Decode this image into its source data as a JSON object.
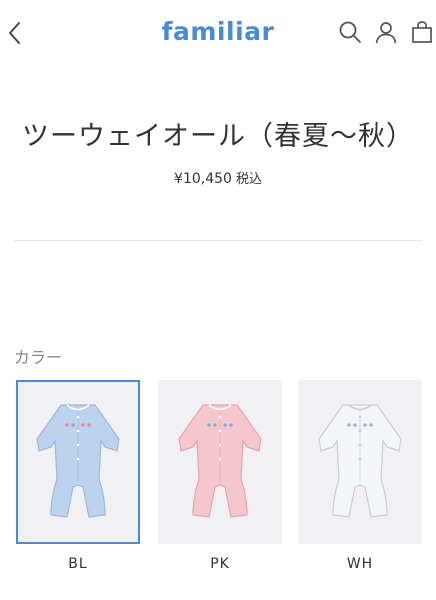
{
  "header": {
    "logo": "familiar",
    "icons": {
      "back": "chevron-left-icon",
      "search": "search-icon",
      "account": "user-icon",
      "bag": "shopping-bag-icon"
    },
    "brand_color": "#4a8ad0"
  },
  "product": {
    "title": "ツーウェイオール（春夏～秋）",
    "price": "¥10,450",
    "tax_label": "税込"
  },
  "color_section": {
    "label": "カラー",
    "selected": "BL",
    "options": [
      {
        "code": "BL",
        "garment_color": "#bcd3ee"
      },
      {
        "code": "PK",
        "garment_color": "#f6c6cf"
      },
      {
        "code": "WH",
        "garment_color": "#f4f5f8"
      }
    ]
  }
}
